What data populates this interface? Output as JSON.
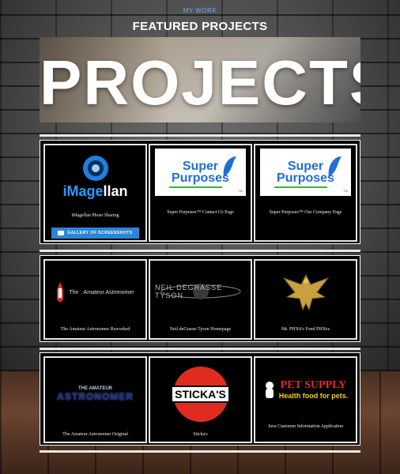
{
  "header": {
    "kicker": "MY WORK",
    "title": "FEATURED PROJECTS",
    "banner_text": "PROJECTS"
  },
  "projects": [
    {
      "caption": "iMagellan Photo Sharing",
      "logo_text_a": "iMage",
      "logo_text_b": "llan",
      "button_label": "GALLERY OF SCREENSHOTS"
    },
    {
      "caption": "Super Purposes™ Contact Us Page",
      "logo_line1": "Super",
      "logo_line2": "Purposes",
      "tm": "TM"
    },
    {
      "caption": "Super Purposes™ Our Company Page",
      "logo_line1": "Super",
      "logo_line2": "Purposes",
      "tm": "TM"
    },
    {
      "caption": "The Amateur Astronomer Reworked",
      "logo_small": "The",
      "logo_text": "Amateur Astronomer"
    },
    {
      "caption": "Neil deGrasse Tyson Homepage",
      "logo_text": "NEIL DEGRASSE TYSON"
    },
    {
      "caption": "Mr. PHXit's Fond PHXes"
    },
    {
      "caption": "The Amateur Astronomer Original",
      "logo_small": "THE AMATEUR",
      "logo_text": "ASTRONOMER"
    },
    {
      "caption": "Sticka's",
      "logo_text": "STICKA'S"
    },
    {
      "caption": "Java Customer Information Application",
      "logo_line1": "PET SUPPLY",
      "logo_line2": "Health food for pets."
    }
  ],
  "colors": {
    "accent_blue": "#2a86d6",
    "kicker_blue": "#6fa6ff",
    "super_purposes_blue": "#1f6fd1",
    "sticka_red": "#e02c1f",
    "pet_red": "#e3262b",
    "pet_yellow": "#f0d020",
    "phx_gold": "#c8a040"
  }
}
